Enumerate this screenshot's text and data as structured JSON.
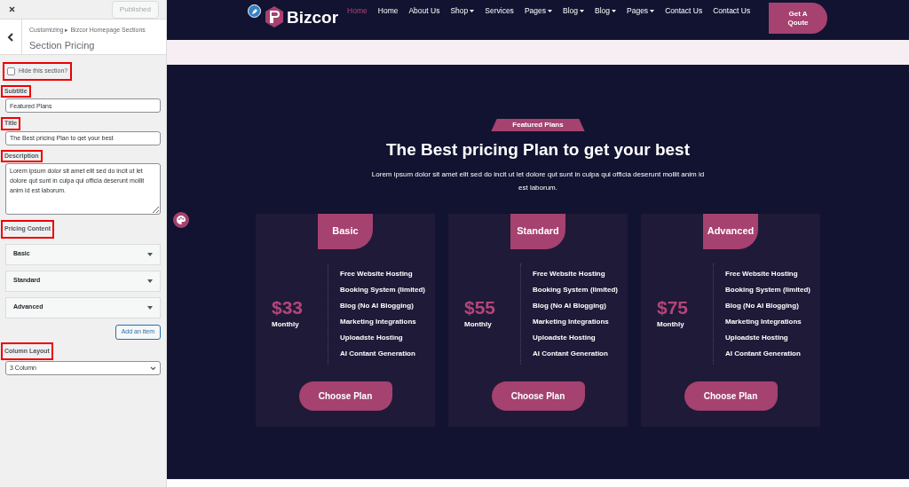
{
  "customizer": {
    "publish_button": "Published",
    "breadcrumb": "Customizing ▸ Bizcor Homepage Sections",
    "section_title": "Section Pricing",
    "hide_section": {
      "label": "Hide this section?",
      "checked": false
    },
    "subtitle": {
      "label": "Subtitle",
      "value": "Featured Plans"
    },
    "title": {
      "label": "Title",
      "value": "The Best pricing Plan to get your best"
    },
    "description": {
      "label": "Description",
      "value": "Lorem ipsum dolor sit amet elit sed do incit ut let dolore qut sunt in culpa qui officia deserunt mollit anim id est laborum."
    },
    "pricing_content": {
      "label": "Pricing Content",
      "items": [
        {
          "label": "Basic",
          "expanded": false
        },
        {
          "label": "Standard",
          "expanded": false
        },
        {
          "label": "Advanced",
          "expanded": false
        }
      ],
      "add_button": "Add an item"
    },
    "column_layout": {
      "label": "Column Layout",
      "value": "3 Column"
    }
  },
  "site": {
    "logo": "Bizcor",
    "nav": [
      {
        "label": "Home",
        "selected": true,
        "dropdown": false
      },
      {
        "label": "Home",
        "selected": false,
        "dropdown": false
      },
      {
        "label": "About Us",
        "selected": false,
        "dropdown": false
      },
      {
        "label": "Shop",
        "selected": false,
        "dropdown": true
      },
      {
        "label": "Services",
        "selected": false,
        "dropdown": false
      },
      {
        "label": "Pages",
        "selected": false,
        "dropdown": true
      },
      {
        "label": "Blog",
        "selected": false,
        "dropdown": true
      },
      {
        "label": "Blog",
        "selected": false,
        "dropdown": true
      },
      {
        "label": "Pages",
        "selected": false,
        "dropdown": true
      },
      {
        "label": "Contact Us",
        "selected": false,
        "dropdown": false
      },
      {
        "label": "Contact Us",
        "selected": false,
        "dropdown": false
      }
    ],
    "cta": "Get A Qoute",
    "pricing": {
      "badge": "Featured Plans",
      "heading": "The Best pricing Plan to get your best",
      "text": "Lorem ipsum dolor sit amet elit sed do incit ut let dolore qut sunt in culpa qui officia deserunt mollit anim id est laborum.",
      "plans": [
        {
          "name": "Basic",
          "price": "$33",
          "period": "Monthly",
          "features": [
            "Free Website Hosting",
            "Booking System (limited)",
            "Blog (No AI Blogging)",
            "Marketing Integrations",
            "Uploadste Hosting",
            "AI Contant Generation"
          ],
          "button": "Choose Plan"
        },
        {
          "name": "Standard",
          "price": "$55",
          "period": "Monthly",
          "features": [
            "Free Website Hosting",
            "Booking System (limited)",
            "Blog (No AI Blogging)",
            "Marketing Integrations",
            "Uploadste Hosting",
            "AI Contant Generation"
          ],
          "button": "Choose Plan"
        },
        {
          "name": "Advanced",
          "price": "$75",
          "period": "Monthly",
          "features": [
            "Free Website Hosting",
            "Booking System (limited)",
            "Blog (No AI Blogging)",
            "Marketing Integrations",
            "Uploadste Hosting",
            "AI Contant Generation"
          ],
          "button": "Choose Plan"
        }
      ]
    }
  }
}
